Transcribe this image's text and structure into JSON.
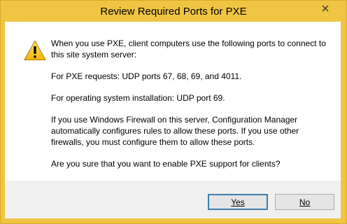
{
  "window": {
    "title": "Review Required Ports for PXE"
  },
  "dialog": {
    "icon": "warning-icon",
    "paragraphs": [
      "When you use PXE, client computers use the following ports to connect to this site system server:",
      "For PXE requests: UDP ports 67, 68, 69, and 4011.",
      "For operating system installation: UDP port 69.",
      "If you use Windows Firewall on this server, Configuration Manager automatically configures rules to allow these ports. If you use other firewalls, you must configure them to allow these ports.",
      "Are you sure that you want to enable PXE support for clients?"
    ]
  },
  "buttons": {
    "yes_label": "Yes",
    "no_label": "No"
  },
  "colors": {
    "frame": "#f0c544",
    "footer": "#f0f0f0",
    "default_button_border": "#3c7fb1"
  }
}
